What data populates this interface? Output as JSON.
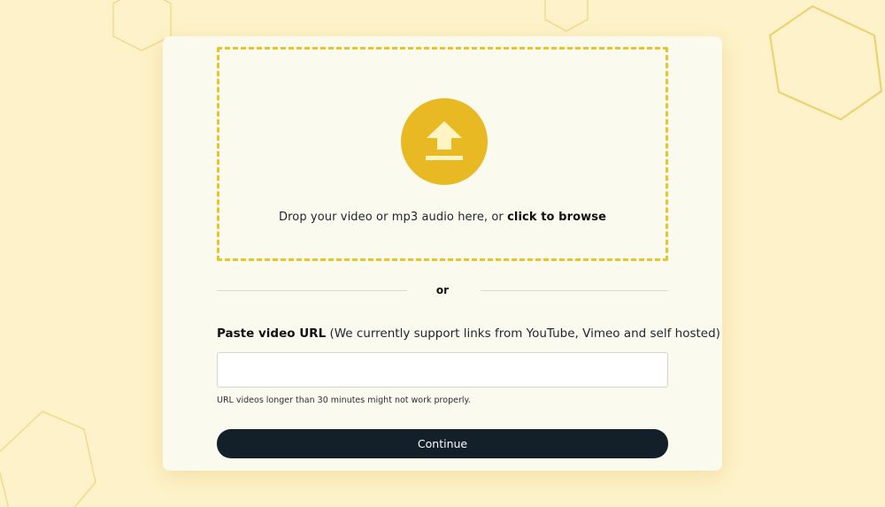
{
  "colors": {
    "background": "#fdf2c9",
    "card": "#fafaee",
    "accent": "#e8b922",
    "dash_border": "#ebc42a",
    "button": "#13202a"
  },
  "upload": {
    "icon": "upload-arrow-icon",
    "text_prefix": "Drop your video or mp3 audio here, or ",
    "text_link": "click to browse"
  },
  "divider": {
    "label": "or"
  },
  "url": {
    "label_bold": "Paste video URL",
    "label_rest": " (We currently support links from YouTube, Vimeo and self hosted)",
    "value": "",
    "placeholder": "",
    "hint": "URL videos longer than 30 minutes might not work properly."
  },
  "actions": {
    "continue_label": "Continue"
  }
}
